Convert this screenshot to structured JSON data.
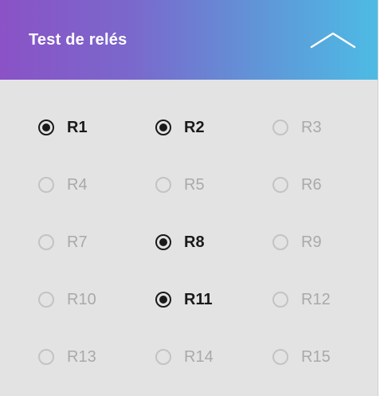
{
  "header": {
    "title": "Test de relés",
    "collapse_icon": "chevron-up-icon"
  },
  "relays": [
    {
      "label": "R1",
      "checked": true
    },
    {
      "label": "R2",
      "checked": true
    },
    {
      "label": "R3",
      "checked": false
    },
    {
      "label": "R4",
      "checked": false
    },
    {
      "label": "R5",
      "checked": false
    },
    {
      "label": "R6",
      "checked": false
    },
    {
      "label": "R7",
      "checked": false
    },
    {
      "label": "R8",
      "checked": true
    },
    {
      "label": "R9",
      "checked": false
    },
    {
      "label": "R10",
      "checked": false
    },
    {
      "label": "R11",
      "checked": true
    },
    {
      "label": "R12",
      "checked": false
    },
    {
      "label": "R13",
      "checked": false
    },
    {
      "label": "R14",
      "checked": false
    },
    {
      "label": "R15",
      "checked": false
    }
  ]
}
